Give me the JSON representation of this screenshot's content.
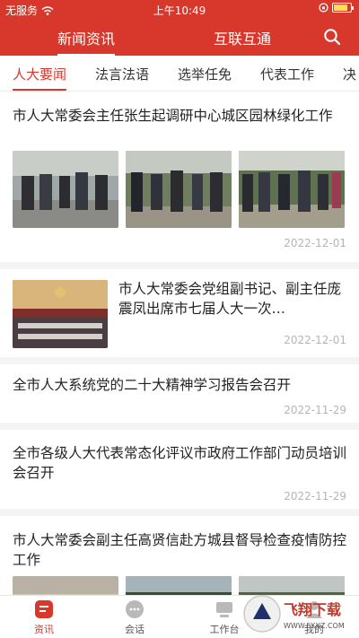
{
  "status": {
    "carrier": "无服务",
    "time": "上午10:49"
  },
  "header": {
    "tabs": [
      {
        "label": "新闻资讯"
      },
      {
        "label": "互联互通"
      }
    ]
  },
  "categories": [
    "人大要闻",
    "法言法语",
    "选举任免",
    "代表工作",
    "决"
  ],
  "feed": [
    {
      "title": "市人大常委会主任张生起调研中心城区园林绿化工作",
      "date": "2022-12-01"
    },
    {
      "title": "市人大常委会党组副书记、副主任庞震凤出席市七届人大一次…",
      "date": "2022-12-01"
    },
    {
      "title": "全市人大系统党的二十大精神学习报告会召开",
      "date": "2022-11-29"
    },
    {
      "title": "全市各级人大代表常态化评议市政府工作部门动员培训会召开",
      "date": "2022-11-29"
    },
    {
      "title": "市人大常委会副主任高贤信赴方城县督导检查疫情防控工作",
      "date": ""
    }
  ],
  "tabbar": [
    {
      "label": "资讯"
    },
    {
      "label": "会话"
    },
    {
      "label": "工作台"
    },
    {
      "label": "我的"
    }
  ],
  "watermark": {
    "text": "飞翔下载",
    "url": "WWW.FXXZ.COM"
  },
  "colors": {
    "brand": "#d8372c",
    "date": "#b5b5b5",
    "divider": "#f4f4f4"
  }
}
